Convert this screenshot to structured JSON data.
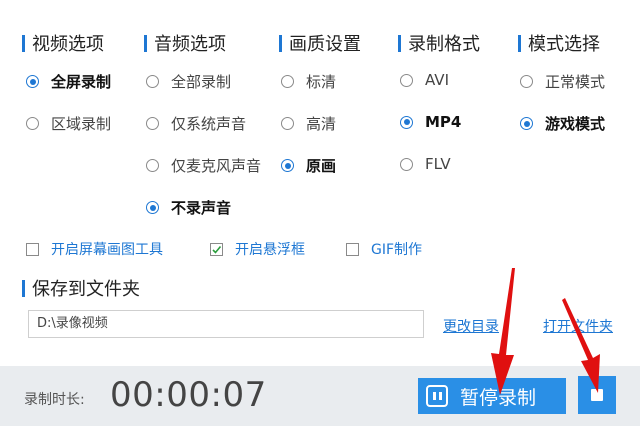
{
  "sections": {
    "video": "视频选项",
    "audio": "音频选项",
    "quality": "画质设置",
    "format": "录制格式",
    "mode": "模式选择"
  },
  "video_options": [
    {
      "label": "全屏录制",
      "selected": true
    },
    {
      "label": "区域录制",
      "selected": false
    }
  ],
  "audio_options": [
    {
      "label": "全部录制",
      "selected": false
    },
    {
      "label": "仅系统声音",
      "selected": false
    },
    {
      "label": "仅麦克风声音",
      "selected": false
    },
    {
      "label": "不录声音",
      "selected": true
    }
  ],
  "quality_options": [
    {
      "label": "标清",
      "selected": false
    },
    {
      "label": "高清",
      "selected": false
    },
    {
      "label": "原画",
      "selected": true
    }
  ],
  "format_options": [
    {
      "label": "AVI",
      "selected": false
    },
    {
      "label": "MP4",
      "selected": true
    },
    {
      "label": "FLV",
      "selected": false
    }
  ],
  "mode_options": [
    {
      "label": "正常模式",
      "selected": false
    },
    {
      "label": "游戏模式",
      "selected": true
    }
  ],
  "checkboxes": [
    {
      "label": "开启屏幕画图工具",
      "checked": false
    },
    {
      "label": "开启悬浮框",
      "checked": true
    },
    {
      "label": "GIF制作",
      "checked": false
    }
  ],
  "save": {
    "title": "保存到文件夹",
    "path": "D:\\录像视频",
    "change_dir": "更改目录",
    "open_folder": "打开文件夹"
  },
  "footer": {
    "duration_label": "录制时长:",
    "timer": "00:00:07",
    "pause_label": "暂停录制"
  },
  "colors": {
    "accent": "#1e77d3",
    "button": "#2a8fe6",
    "arrow": "#e01010"
  }
}
